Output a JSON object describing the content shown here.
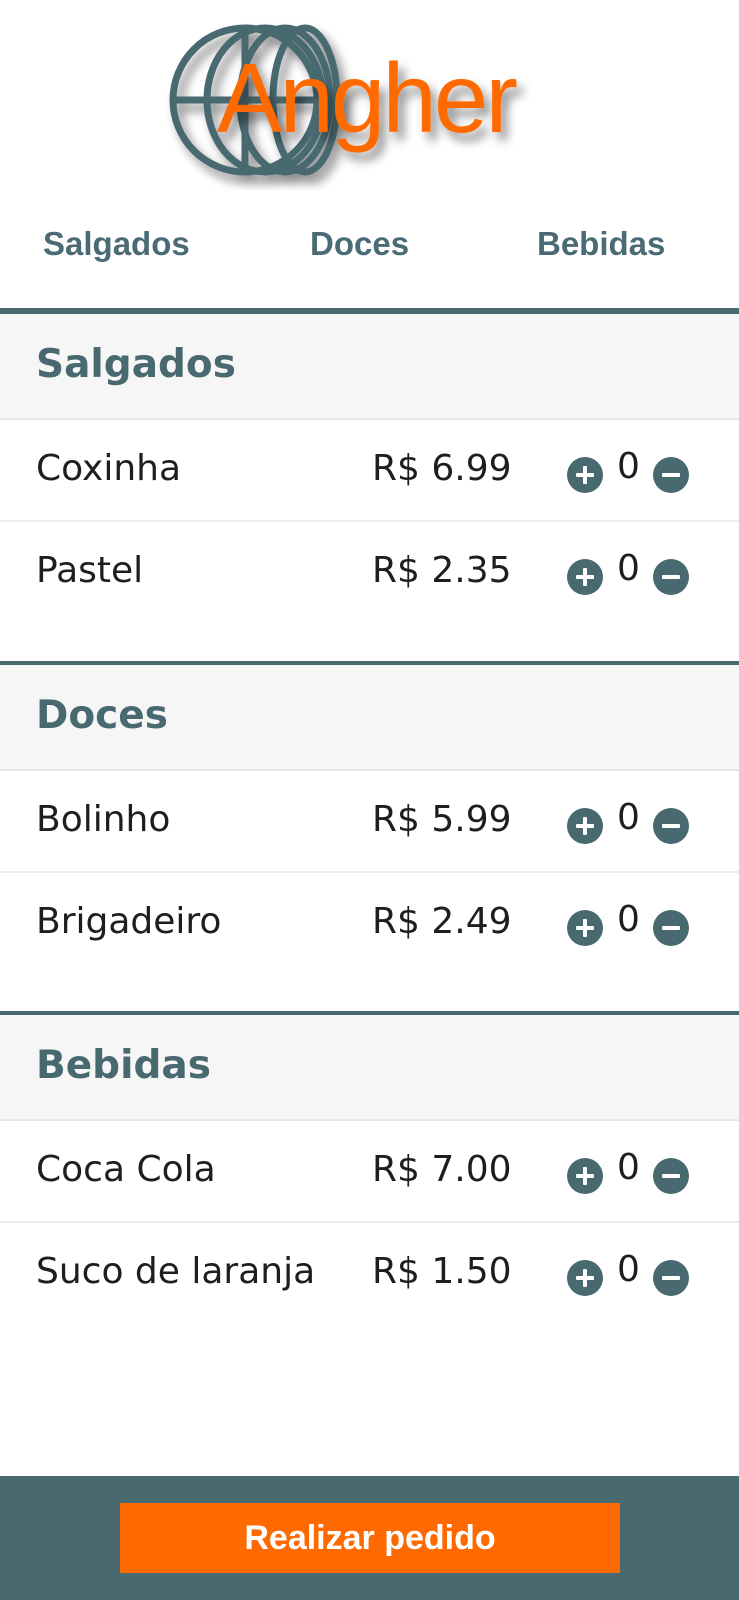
{
  "brand": {
    "logo_text": "Angher",
    "logo_color": "#ff6a00",
    "globe_color": "#48696f"
  },
  "nav": {
    "tabs": [
      {
        "label": "Salgados"
      },
      {
        "label": "Doces"
      },
      {
        "label": "Bebidas"
      }
    ]
  },
  "colors": {
    "accent": "#48696f",
    "button": "#ff6a00",
    "header_bg": "#f6f6f7"
  },
  "sections": [
    {
      "title": "Salgados",
      "items": [
        {
          "name": "Coxinha",
          "price": "R$ 6.99",
          "qty": "0"
        },
        {
          "name": "Pastel",
          "price": "R$ 2.35",
          "qty": "0"
        }
      ]
    },
    {
      "title": "Doces",
      "items": [
        {
          "name": "Bolinho",
          "price": "R$ 5.99",
          "qty": "0"
        },
        {
          "name": "Brigadeiro",
          "price": "R$ 2.49",
          "qty": "0"
        }
      ]
    },
    {
      "title": "Bebidas",
      "items": [
        {
          "name": "Coca Cola",
          "price": "R$ 7.00",
          "qty": "0"
        },
        {
          "name": "Suco de laranja",
          "price": "R$ 1.50",
          "qty": "0"
        }
      ]
    }
  ],
  "icons": {
    "increment": "plus-icon",
    "decrement": "minus-icon"
  },
  "footer": {
    "order_label": "Realizar pedido"
  }
}
